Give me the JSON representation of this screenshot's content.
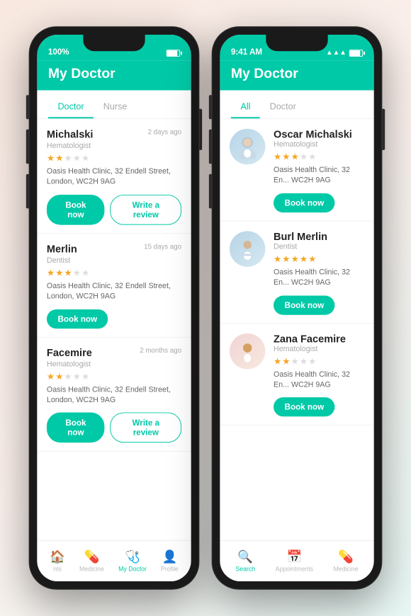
{
  "app": {
    "title": "My Doctor",
    "accent_color": "#00c9a7"
  },
  "phone_left": {
    "status_bar": {
      "battery": "100%"
    },
    "tabs": [
      {
        "label": "Doctor",
        "active": true
      },
      {
        "label": "Nurse",
        "active": false
      }
    ],
    "doctors": [
      {
        "name": "Michalski",
        "full_name": "Oscar Michalski",
        "specialty": "Hematologist",
        "time_ago": "2 days ago",
        "rating": 2,
        "max_rating": 5,
        "address": "Oasis Health Clinic, 32 Endell Street, London, WC2H 9AG",
        "has_review": true,
        "book_label": "Book now",
        "review_label": "Write a review"
      },
      {
        "name": "Merlin",
        "full_name": "Burl Merlin",
        "specialty": "Dentist",
        "time_ago": "15 days ago",
        "rating": 3,
        "max_rating": 5,
        "address": "Oasis Health Clinic, 32 Endell Street, London, WC2H 9AG",
        "has_review": false,
        "book_label": "Book now",
        "review_label": ""
      },
      {
        "name": "Facemire",
        "full_name": "Zana Facemire",
        "specialty": "Hematologist",
        "time_ago": "2 months ago",
        "rating": 2,
        "max_rating": 5,
        "address": "Oasis Health Clinic, 32 Endell Street, London, WC2H 9AG",
        "has_review": true,
        "book_label": "Book now",
        "review_label": "Write a review"
      }
    ],
    "bottom_nav": [
      {
        "icon": "🏠",
        "label": "nts",
        "active": false
      },
      {
        "icon": "💊",
        "label": "Medicine",
        "active": false
      },
      {
        "icon": "🩺",
        "label": "My Doctor",
        "active": true
      },
      {
        "icon": "👤",
        "label": "Profile",
        "active": false
      }
    ]
  },
  "phone_right": {
    "status_bar": {
      "time": "9:41 AM"
    },
    "header_title": "My Doctor",
    "tabs": [
      {
        "label": "All",
        "active": true
      },
      {
        "label": "Doctor",
        "active": false
      }
    ],
    "doctors": [
      {
        "name": "Oscar Michalski",
        "specialty": "Hematologist",
        "rating": 3,
        "max_rating": 5,
        "address": "Oasis Health Clinic, 32 En... WC2H 9AG",
        "gender": "male",
        "book_label": "Book now"
      },
      {
        "name": "Burl Merlin",
        "specialty": "Dentist",
        "rating": 5,
        "max_rating": 5,
        "address": "Oasis Health Clinic, 32 En... WC2H 9AG",
        "gender": "male",
        "book_label": "Book now"
      },
      {
        "name": "Zana Facemire",
        "specialty": "Hematologist",
        "rating": 2,
        "max_rating": 5,
        "address": "Oasis Health Clinic, 32 En... WC2H 9AG",
        "gender": "female",
        "book_label": "Book now"
      }
    ],
    "bottom_nav": [
      {
        "icon": "🔍",
        "label": "Search",
        "active": true
      },
      {
        "icon": "📅",
        "label": "Appointments",
        "active": false
      },
      {
        "icon": "💊",
        "label": "Medicine",
        "active": false
      }
    ]
  }
}
